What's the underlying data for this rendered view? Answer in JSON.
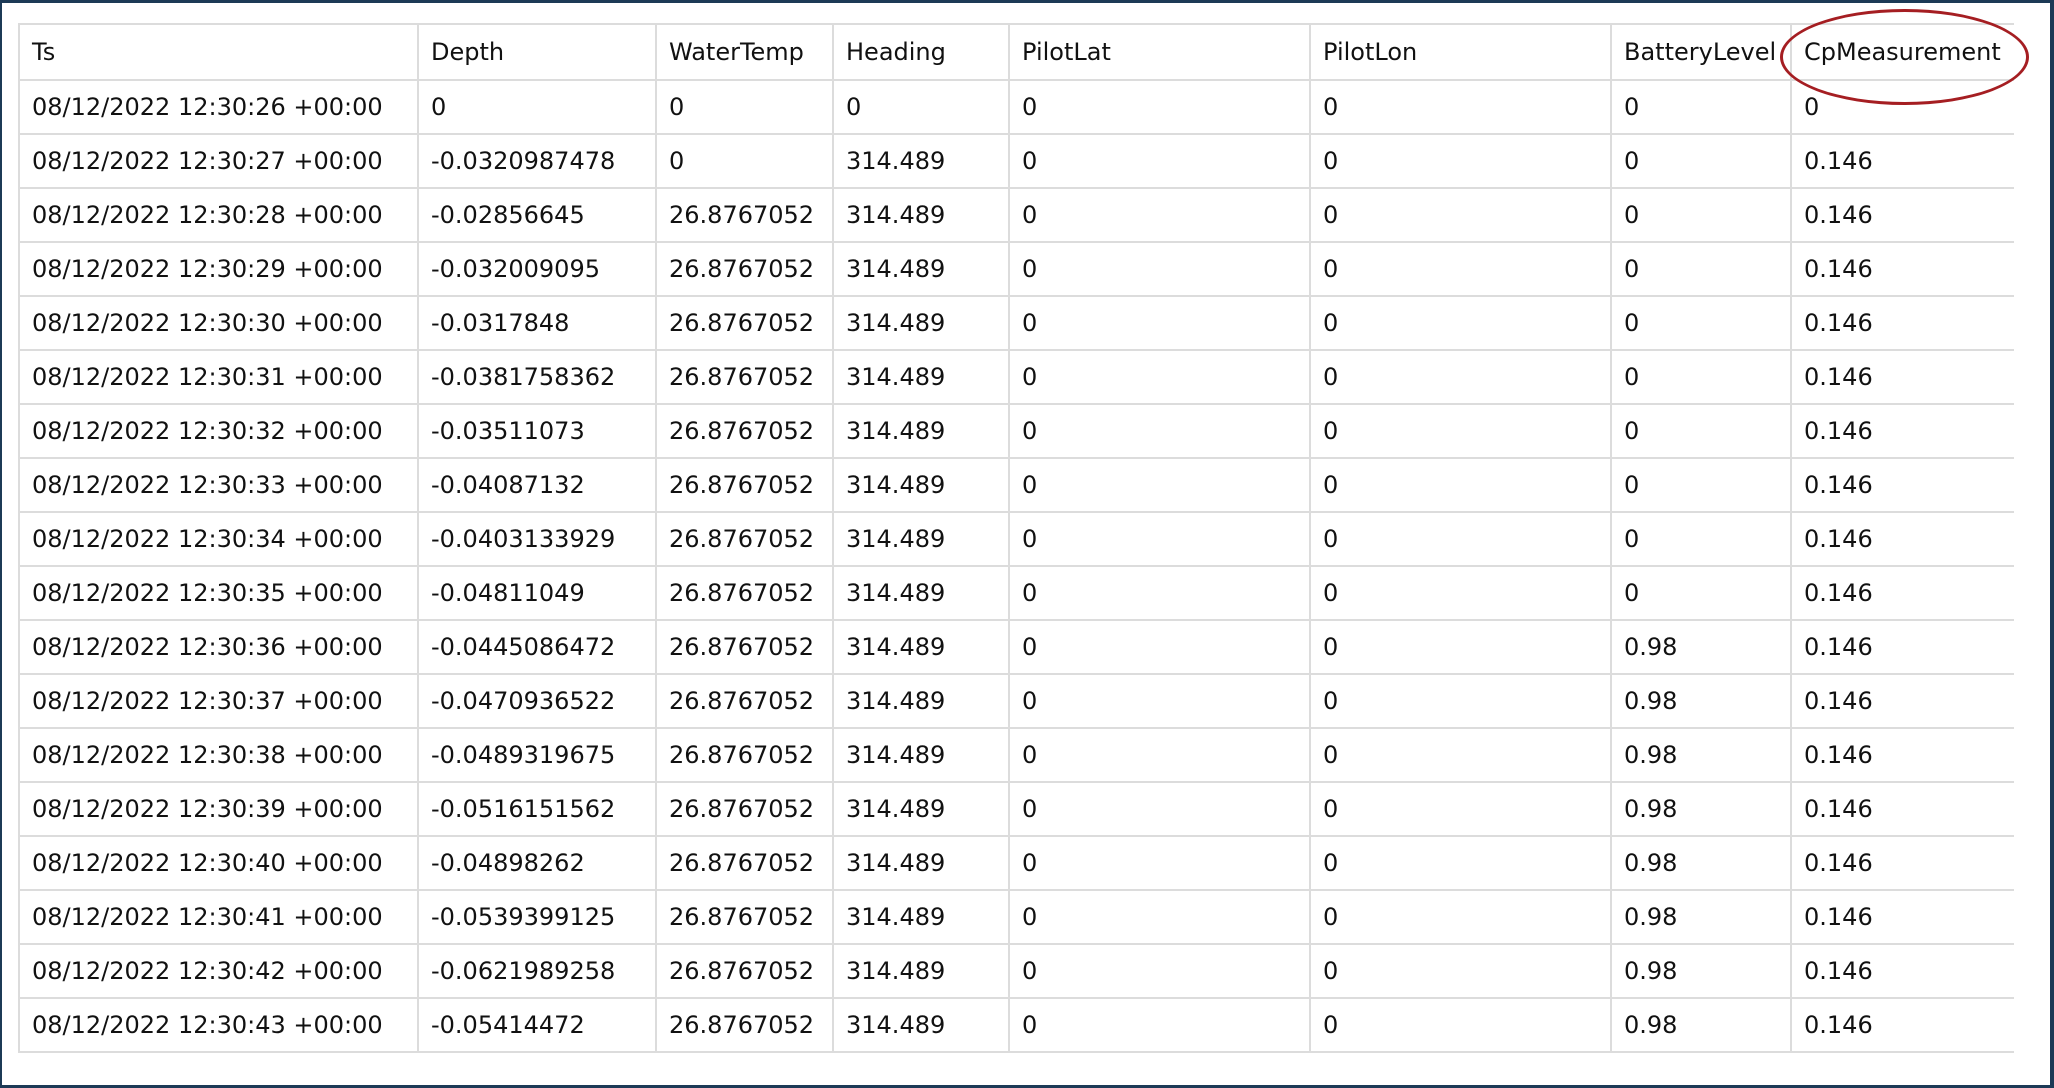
{
  "table": {
    "columns": [
      "Ts",
      "Depth",
      "WaterTemp",
      "Heading",
      "PilotLat",
      "PilotLon",
      "BatteryLevel",
      "CpMeasurement"
    ],
    "rows": [
      [
        "08/12/2022 12:30:26 +00:00",
        "0",
        "0",
        "0",
        "0",
        "0",
        "0",
        "0"
      ],
      [
        "08/12/2022 12:30:27 +00:00",
        "-0.0320987478",
        "0",
        "314.489",
        "0",
        "0",
        "0",
        "0.146"
      ],
      [
        "08/12/2022 12:30:28 +00:00",
        "-0.02856645",
        "26.8767052",
        "314.489",
        "0",
        "0",
        "0",
        "0.146"
      ],
      [
        "08/12/2022 12:30:29 +00:00",
        "-0.032009095",
        "26.8767052",
        "314.489",
        "0",
        "0",
        "0",
        "0.146"
      ],
      [
        "08/12/2022 12:30:30 +00:00",
        "-0.0317848",
        "26.8767052",
        "314.489",
        "0",
        "0",
        "0",
        "0.146"
      ],
      [
        "08/12/2022 12:30:31 +00:00",
        "-0.0381758362",
        "26.8767052",
        "314.489",
        "0",
        "0",
        "0",
        "0.146"
      ],
      [
        "08/12/2022 12:30:32 +00:00",
        "-0.03511073",
        "26.8767052",
        "314.489",
        "0",
        "0",
        "0",
        "0.146"
      ],
      [
        "08/12/2022 12:30:33 +00:00",
        "-0.04087132",
        "26.8767052",
        "314.489",
        "0",
        "0",
        "0",
        "0.146"
      ],
      [
        "08/12/2022 12:30:34 +00:00",
        "-0.0403133929",
        "26.8767052",
        "314.489",
        "0",
        "0",
        "0",
        "0.146"
      ],
      [
        "08/12/2022 12:30:35 +00:00",
        "-0.04811049",
        "26.8767052",
        "314.489",
        "0",
        "0",
        "0",
        "0.146"
      ],
      [
        "08/12/2022 12:30:36 +00:00",
        "-0.0445086472",
        "26.8767052",
        "314.489",
        "0",
        "0",
        "0.98",
        "0.146"
      ],
      [
        "08/12/2022 12:30:37 +00:00",
        "-0.0470936522",
        "26.8767052",
        "314.489",
        "0",
        "0",
        "0.98",
        "0.146"
      ],
      [
        "08/12/2022 12:30:38 +00:00",
        "-0.0489319675",
        "26.8767052",
        "314.489",
        "0",
        "0",
        "0.98",
        "0.146"
      ],
      [
        "08/12/2022 12:30:39 +00:00",
        "-0.0516151562",
        "26.8767052",
        "314.489",
        "0",
        "0",
        "0.98",
        "0.146"
      ],
      [
        "08/12/2022 12:30:40 +00:00",
        "-0.04898262",
        "26.8767052",
        "314.489",
        "0",
        "0",
        "0.98",
        "0.146"
      ],
      [
        "08/12/2022 12:30:41 +00:00",
        "-0.0539399125",
        "26.8767052",
        "314.489",
        "0",
        "0",
        "0.98",
        "0.146"
      ],
      [
        "08/12/2022 12:30:42 +00:00",
        "-0.0621989258",
        "26.8767052",
        "314.489",
        "0",
        "0",
        "0.98",
        "0.146"
      ],
      [
        "08/12/2022 12:30:43 +00:00",
        "-0.05414472",
        "26.8767052",
        "314.489",
        "0",
        "0",
        "0.98",
        "0.146"
      ]
    ]
  },
  "annotation": {
    "highlighted_column": "CpMeasurement",
    "color": "#a51e22"
  }
}
